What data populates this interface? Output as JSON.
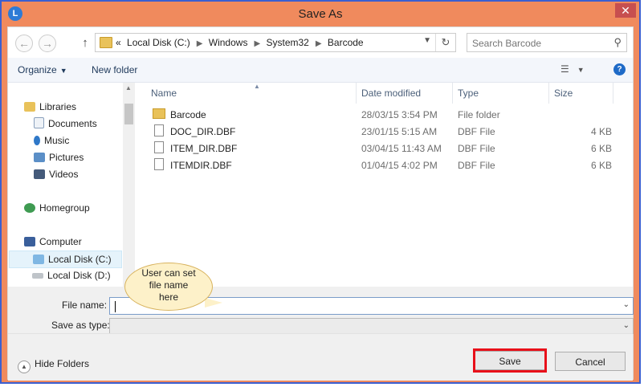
{
  "window": {
    "title": "Save As",
    "close": "✕",
    "app_icon": "L"
  },
  "nav_buttons": {
    "back": "←",
    "forward": "→",
    "up": "↑"
  },
  "address": {
    "crumbs": [
      "«",
      "Local Disk (C:)",
      "Windows",
      "System32",
      "Barcode"
    ],
    "refresh_glyph": "↻"
  },
  "search": {
    "placeholder": "Search Barcode",
    "icon": "search-icon"
  },
  "toolbar": {
    "organize": "Organize",
    "new_folder": "New folder",
    "help": "?"
  },
  "navpane": {
    "libraries": "Libraries",
    "documents": "Documents",
    "music": "Music",
    "pictures": "Pictures",
    "videos": "Videos",
    "homegroup": "Homegroup",
    "computer": "Computer",
    "local_c": "Local Disk (C:)",
    "local_d": "Local Disk (D:)"
  },
  "columns": {
    "name": "Name",
    "date": "Date modified",
    "type": "Type",
    "size": "Size"
  },
  "files": [
    {
      "name": "Barcode",
      "date": "28/03/15 3:54 PM",
      "type": "File folder",
      "size": "",
      "kind": "folder"
    },
    {
      "name": "DOC_DIR.DBF",
      "date": "23/01/15 5:15 AM",
      "type": "DBF File",
      "size": "4 KB",
      "kind": "file"
    },
    {
      "name": "ITEM_DIR.DBF",
      "date": "03/04/15 11:43 AM",
      "type": "DBF File",
      "size": "6 KB",
      "kind": "file"
    },
    {
      "name": "ITEMDIR.DBF",
      "date": "01/04/15 4:02 PM",
      "type": "DBF File",
      "size": "6 KB",
      "kind": "file"
    }
  ],
  "form": {
    "file_name_label": "File name:",
    "file_name_value": "",
    "save_type_label": "Save as type:",
    "save_type_value": ""
  },
  "footer": {
    "hide_folders": "Hide Folders",
    "save": "Save",
    "cancel": "Cancel"
  },
  "callout": {
    "line1": "User can set",
    "line2": "file name",
    "line3": "here"
  },
  "colors": {
    "frame": "#f08a5d",
    "border": "#3b5fd0",
    "highlight": "#e8101a",
    "callout_fill": "#fdf1c9"
  }
}
